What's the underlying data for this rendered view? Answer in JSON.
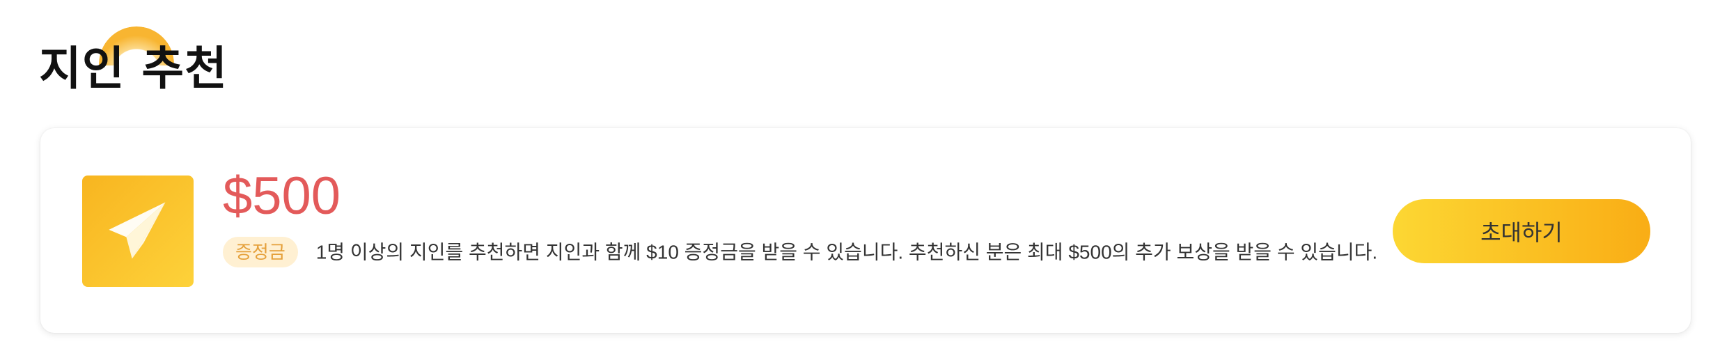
{
  "header": {
    "title": "지인 추천"
  },
  "referral_card": {
    "icon": "paper-plane-icon",
    "amount": "$500",
    "badge": "증정금",
    "description": "1명 이상의 지인를 추천하면 지인과 함께 $10 증정금을 받을 수 있습니다. 추천하신 분은 최대 $500의 추가 보상을 받을 수 있습니다.",
    "invite_button": "초대하기"
  },
  "colors": {
    "amount": "#e35a5a",
    "accent_start": "#fcd733",
    "accent_end": "#f9ad15",
    "badge_bg": "#fff0d2",
    "badge_text": "#e5a03a"
  }
}
